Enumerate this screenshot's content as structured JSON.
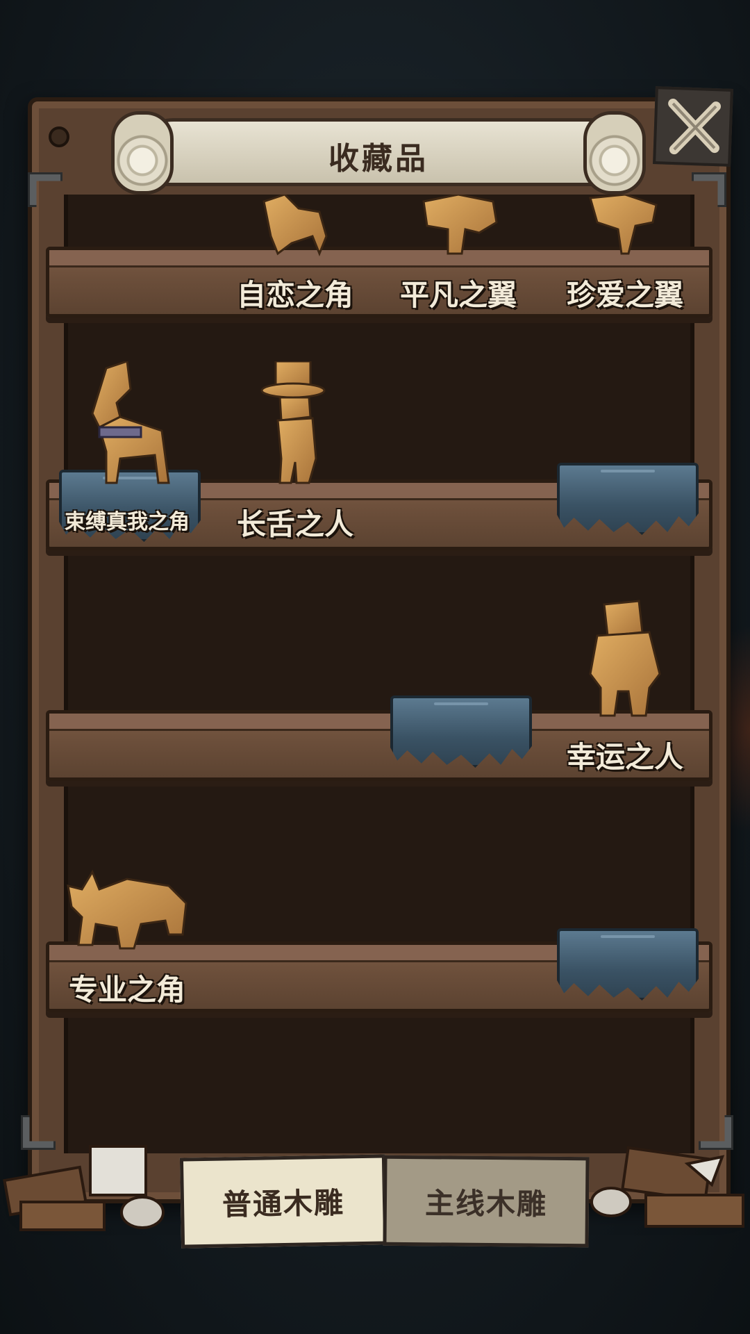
{
  "header": {
    "title": "收藏品"
  },
  "close_button": {
    "icon": "close-icon"
  },
  "shelves": [
    {
      "items": [
        {
          "label": "自恋之角",
          "status": "collected",
          "figure": "horned-creature"
        },
        {
          "label": "平凡之翼",
          "status": "collected",
          "figure": "winged-creature"
        },
        {
          "label": "珍爱之翼",
          "status": "collected",
          "figure": "bird-creature"
        }
      ]
    },
    {
      "items": [
        {
          "label": "束缚真我之角",
          "status": "collected",
          "figure": "horned-dog"
        },
        {
          "label": "长舌之人",
          "status": "collected",
          "figure": "top-hat-man"
        },
        {
          "label": "",
          "status": "locked",
          "figure": "cloth-cover"
        }
      ]
    },
    {
      "items": [
        {
          "label": "",
          "status": "locked",
          "figure": "cloth-cover"
        },
        {
          "label": "幸运之人",
          "status": "collected",
          "figure": "chubby-man"
        }
      ]
    },
    {
      "items": [
        {
          "label": "专业之角",
          "status": "collected",
          "figure": "bull"
        },
        {
          "label": "",
          "status": "locked",
          "figure": "cloth-cover"
        }
      ]
    }
  ],
  "tabs": [
    {
      "label": "普通木雕",
      "active": true
    },
    {
      "label": "主线木雕",
      "active": false
    }
  ],
  "colors": {
    "wood": "#5a4130",
    "shelf": "#6b4e3a",
    "figure": "#c9944f",
    "cloth": "#3a5264",
    "label": "#f2ead8"
  }
}
